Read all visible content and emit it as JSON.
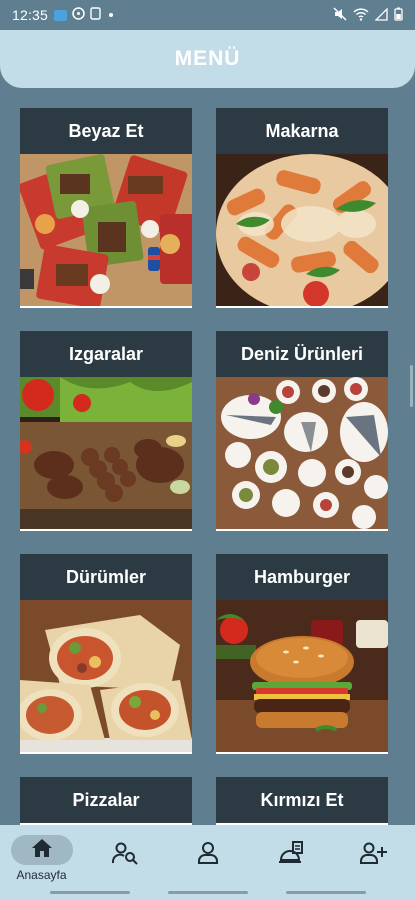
{
  "status_bar": {
    "time": "12:35"
  },
  "header": {
    "title": "MENÜ"
  },
  "categories": [
    {
      "label": "Beyaz Et"
    },
    {
      "label": "Makarna"
    },
    {
      "label": "Izgaralar"
    },
    {
      "label": "Deniz Ürünleri"
    },
    {
      "label": "Dürümler"
    },
    {
      "label": "Hamburger"
    },
    {
      "label": "Pizzalar"
    },
    {
      "label": "Kırmızı Et"
    }
  ],
  "bottom_nav": {
    "items": [
      {
        "icon": "home-icon",
        "label": "Anasayfa",
        "active": true
      },
      {
        "icon": "user-search-icon"
      },
      {
        "icon": "user-icon"
      },
      {
        "icon": "order-icon"
      },
      {
        "icon": "add-user-icon"
      }
    ]
  },
  "colors": {
    "background": "#5f7f91",
    "header": "#c3dde8",
    "card_title_bg": "#2c3a44",
    "active_pill": "#9fb8c4"
  }
}
